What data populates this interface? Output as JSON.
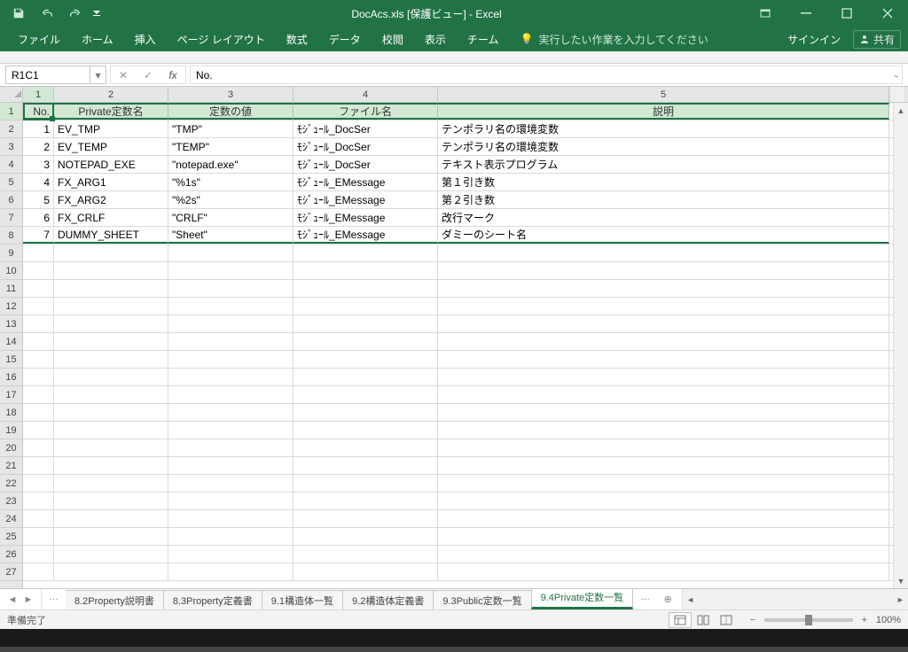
{
  "window": {
    "title": "DocAcs.xls  [保護ビュー] - Excel",
    "signin": "サインイン",
    "share": "共有"
  },
  "ribbon": {
    "file": "ファイル",
    "tabs": [
      "ホーム",
      "挿入",
      "ページ レイアウト",
      "数式",
      "データ",
      "校閲",
      "表示",
      "チーム"
    ],
    "tellme": "実行したい作業を入力してください"
  },
  "formula_bar": {
    "namebox": "R1C1",
    "fx": "fx",
    "value": "No."
  },
  "columns": [
    "1",
    "2",
    "3",
    "4",
    "5"
  ],
  "headers": {
    "no": "No.",
    "name": "Private定数名",
    "value": "定数の値",
    "file": "ファイル名",
    "desc": "説明"
  },
  "rows": [
    {
      "no": "1",
      "name": "EV_TMP",
      "value": "\"TMP\"",
      "file": "ﾓｼﾞｭｰﾙ_DocSer",
      "desc": "テンポラリ名の環境変数"
    },
    {
      "no": "2",
      "name": "EV_TEMP",
      "value": "\"TEMP\"",
      "file": "ﾓｼﾞｭｰﾙ_DocSer",
      "desc": "テンポラリ名の環境変数"
    },
    {
      "no": "3",
      "name": "NOTEPAD_EXE",
      "value": "\"notepad.exe\"",
      "file": "ﾓｼﾞｭｰﾙ_DocSer",
      "desc": "テキスト表示プログラム"
    },
    {
      "no": "4",
      "name": "FX_ARG1",
      "value": "\"%1s\"",
      "file": "ﾓｼﾞｭｰﾙ_EMessage",
      "desc": "第１引き数"
    },
    {
      "no": "5",
      "name": "FX_ARG2",
      "value": "\"%2s\"",
      "file": "ﾓｼﾞｭｰﾙ_EMessage",
      "desc": "第２引き数"
    },
    {
      "no": "6",
      "name": "FX_CRLF",
      "value": "\"CRLF\"",
      "file": "ﾓｼﾞｭｰﾙ_EMessage",
      "desc": "改行マーク"
    },
    {
      "no": "7",
      "name": "DUMMY_SHEET",
      "value": "\"Sheet\"",
      "file": "ﾓｼﾞｭｰﾙ_EMessage",
      "desc": "ダミーのシート名"
    }
  ],
  "empty_row_labels": [
    "9",
    "10",
    "11",
    "12",
    "13",
    "14",
    "15",
    "16",
    "17",
    "18",
    "19",
    "20",
    "21",
    "22",
    "23",
    "24",
    "25",
    "26",
    "27"
  ],
  "sheet_tabs": {
    "visible": [
      "8.2Property説明書",
      "8.3Property定義書",
      "9.1構造体一覧",
      "9.2構造体定義書",
      "9.3Public定数一覧",
      "9.4Private定数一覧"
    ],
    "active_index": 5
  },
  "statusbar": {
    "ready": "準備完了",
    "zoom": "100%"
  }
}
